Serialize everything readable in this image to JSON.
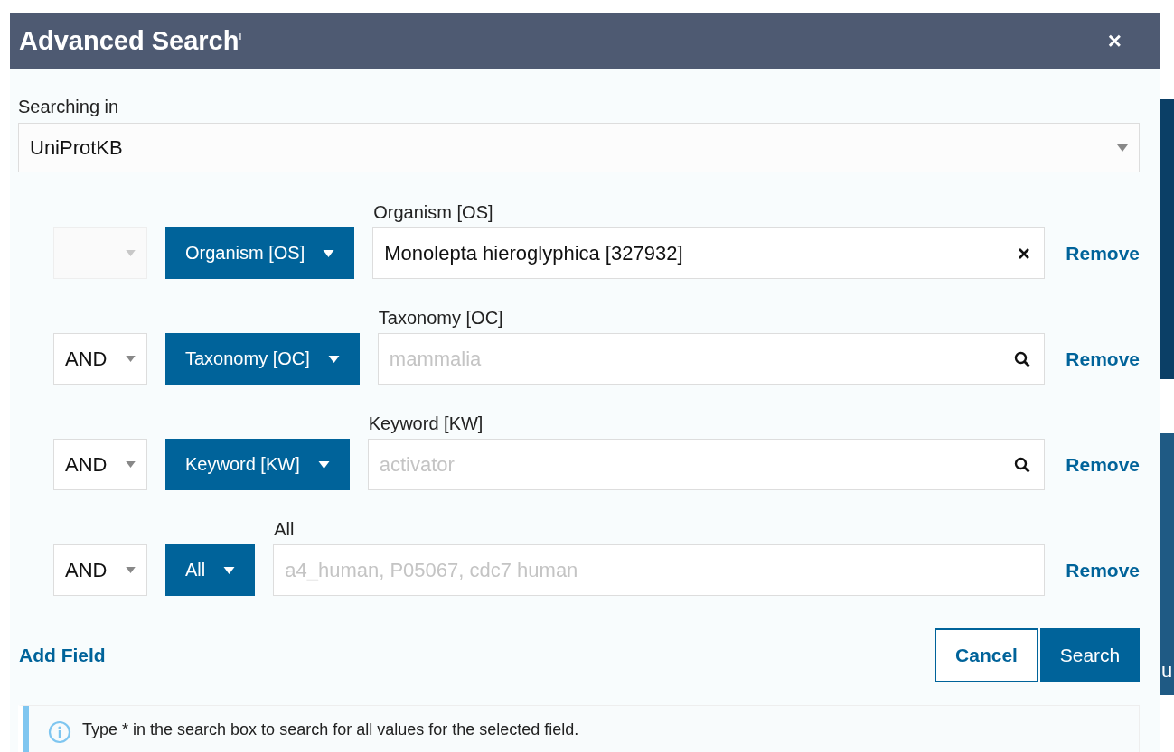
{
  "dialog": {
    "title": "Advanced Search$^{i}$",
    "close": "×"
  },
  "searching_in": {
    "label": "Searching in",
    "value": "UniProtKB"
  },
  "rows": [
    {
      "operator": {
        "disabled": true
      },
      "field": "Organism [OS]",
      "label": "Organism [OS]",
      "value": "Monolepta hieroglyphica [327932]",
      "kind": "clear",
      "remove": "Remove"
    },
    {
      "operator": {
        "value": "AND",
        "disabled": false
      },
      "field": "Taxonomy [OC]",
      "label": "Taxonomy [OC]",
      "placeholder": "mammalia",
      "kind": "search",
      "remove": "Remove"
    },
    {
      "operator": {
        "value": "AND",
        "disabled": false
      },
      "field": "Keyword [KW]",
      "label": "Keyword [KW]",
      "placeholder": "activator",
      "kind": "search",
      "remove": "Remove"
    },
    {
      "operator": {
        "value": "AND",
        "disabled": false
      },
      "field": "All",
      "label": "All",
      "placeholder": "a4_human, P05067, cdc7 human",
      "remove": "Remove"
    }
  ],
  "add_field": "Add Field",
  "buttons": {
    "cancel": "Cancel",
    "search": "Search"
  },
  "info": "Type * in the search box to search for all values for the selected field.",
  "background": {
    "panel_text": "u"
  }
}
